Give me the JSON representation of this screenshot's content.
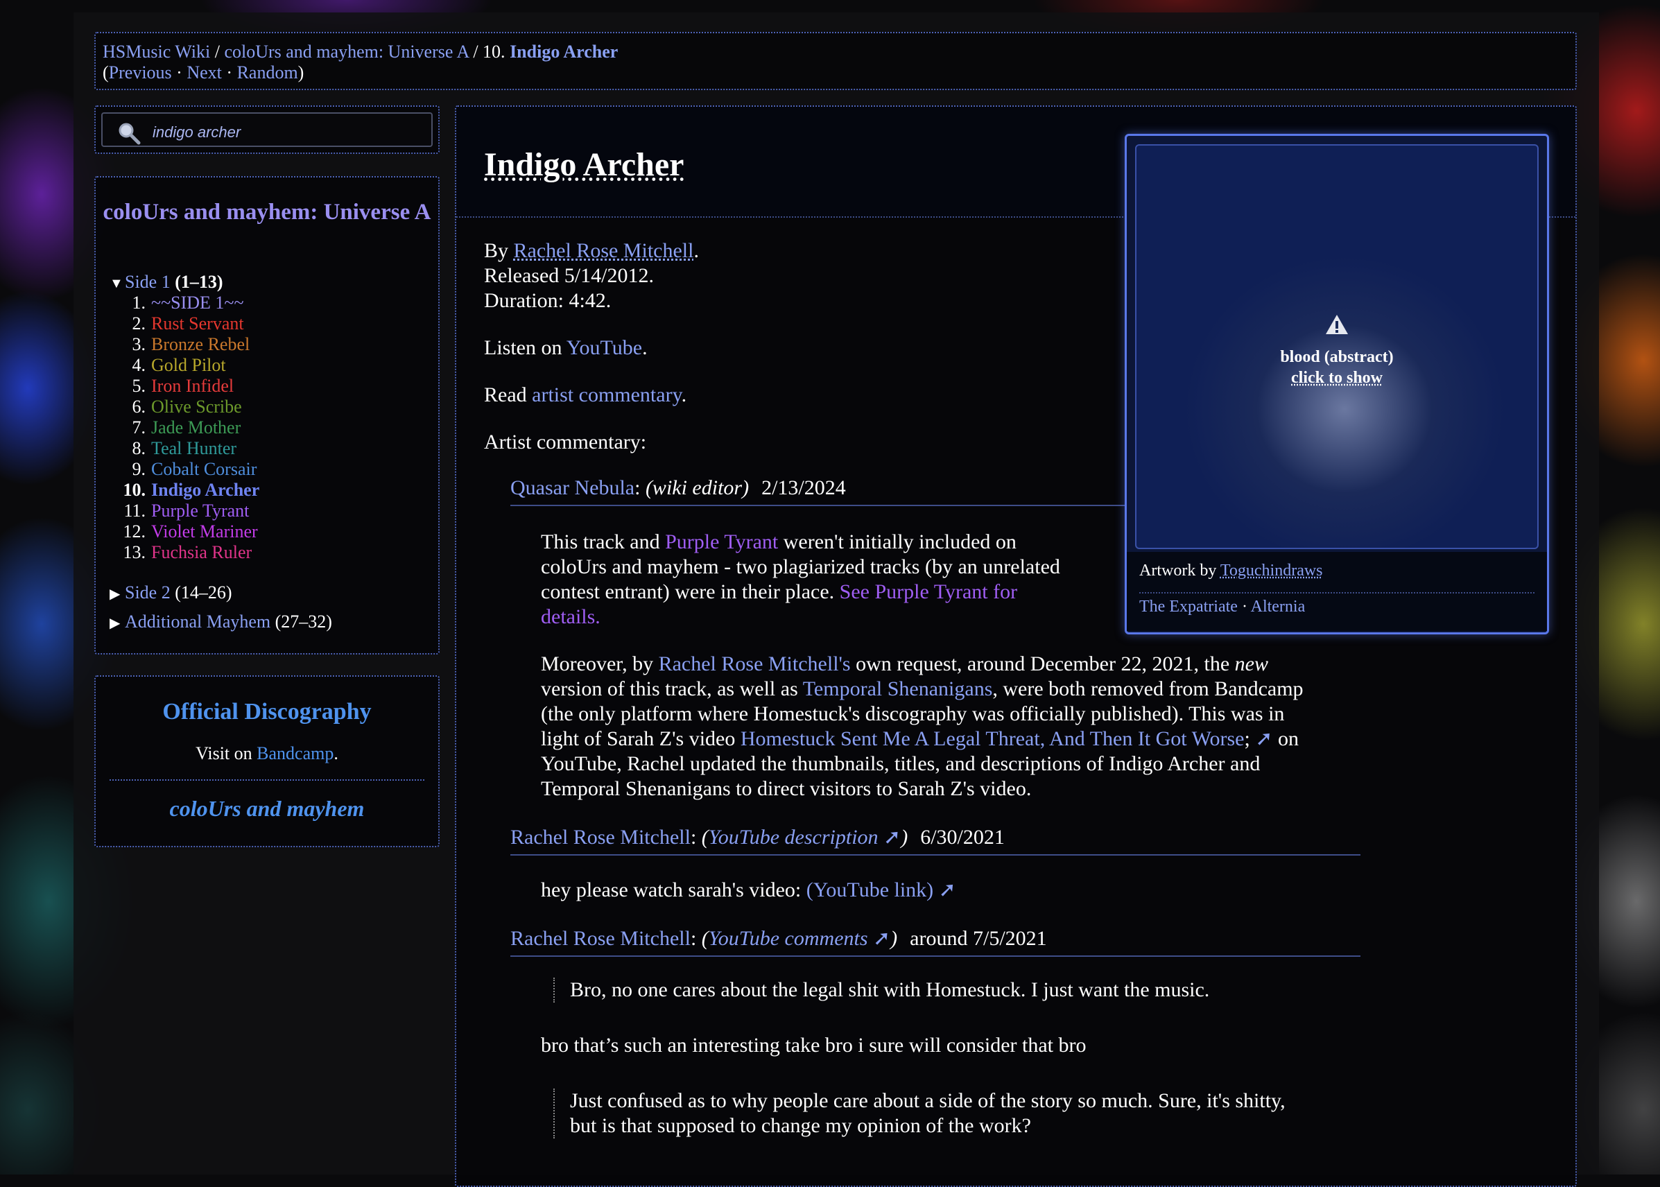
{
  "colors": {
    "link": "#8aa0f2",
    "purple_link": "#a05ef4",
    "official": "#4f93ee",
    "border": "#4e63b8"
  },
  "nav": {
    "home": "HSMusic Wiki",
    "sep1": " / ",
    "album": "coloUrs and mayhem: Universe A",
    "sep2": " / 10. ",
    "current": "Indigo Archer",
    "open_paren": "(",
    "previous": "Previous",
    "dot1": " · ",
    "next": "Next",
    "dot2": " · ",
    "random": "Random",
    "close_paren": ")"
  },
  "search": {
    "icon": "magnifier-icon",
    "value": "indigo archer"
  },
  "sidebar": {
    "album_title": "coloUrs and mayhem: Universe A",
    "side1": {
      "label": "Side 1",
      "range": " (1–13)"
    },
    "tracks": [
      {
        "num": "1.",
        "title": "~~SIDE 1~~",
        "color": "#9a8ff0"
      },
      {
        "num": "2.",
        "title": "Rust Servant",
        "color": "#e5372e"
      },
      {
        "num": "3.",
        "title": "Bronze Rebel",
        "color": "#c9782c"
      },
      {
        "num": "4.",
        "title": "Gold Pilot",
        "color": "#b7a72b"
      },
      {
        "num": "5.",
        "title": "Iron Infidel",
        "color": "#e53b3b"
      },
      {
        "num": "6.",
        "title": "Olive Scribe",
        "color": "#6d9a2b"
      },
      {
        "num": "7.",
        "title": "Jade Mother",
        "color": "#3c9a55"
      },
      {
        "num": "8.",
        "title": "Teal Hunter",
        "color": "#2f9a9a"
      },
      {
        "num": "9.",
        "title": "Cobalt Corsair",
        "color": "#4f8edd"
      },
      {
        "num": "10.",
        "title": "Indigo Archer",
        "color": "#6f84f2"
      },
      {
        "num": "11.",
        "title": "Purple Tyrant",
        "color": "#a05ef4"
      },
      {
        "num": "12.",
        "title": "Violet Mariner",
        "color": "#c23ce8"
      },
      {
        "num": "13.",
        "title": "Fuchsia Ruler",
        "color": "#e0348a"
      }
    ],
    "side2": {
      "label": "Side 2",
      "range": " (14–26)"
    },
    "additional": {
      "label": "Additional Mayhem",
      "range": " (27–32)"
    }
  },
  "discography": {
    "title": "Official Discography",
    "visit_prefix": "Visit on ",
    "visit_link": "Bandcamp",
    "visit_suffix": ".",
    "album": "coloUrs and mayhem"
  },
  "track": {
    "title": "Indigo Archer",
    "by_prefix": "By ",
    "artist": "Rachel Rose Mitchell",
    "by_suffix": ".",
    "released": "Released 5/14/2012.",
    "duration": "Duration: 4:42.",
    "listen_prefix": "Listen on ",
    "listen_link": "YouTube",
    "listen_suffix": ".",
    "read_prefix": "Read ",
    "read_link": "artist commentary",
    "read_suffix": ".",
    "commentary_heading": "Artist commentary:"
  },
  "commentary": [
    {
      "author": "Quasar Nebula",
      "colon": ": ",
      "source": "(wiki editor)",
      "date": "2/13/2024",
      "p1": {
        "a": "This track and ",
        "link1": "Purple Tyrant",
        "b": " weren't initially included on",
        "line2": "coloUrs and mayhem - two plagiarized tracks (by an unrelated",
        "line3a": "contest entrant) were in their place. ",
        "link2a": "See Purple Tyrant for",
        "link2b": "details."
      },
      "p2": {
        "a": "Moreover, by ",
        "link1": "Rachel Rose Mitchell's",
        "b": " own request, around December 22, 2021, the ",
        "em": "new",
        "line2a": "version of this track, as well as ",
        "link2": "Temporal Shenanigans",
        "line2b": ", were both removed from Bandcamp",
        "line3": "(the only platform where Homestuck's discography was officially published). This was in",
        "line4a": "light of Sarah Z's video ",
        "link3": "Homestuck Sent Me A Legal Threat, And Then It Got Worse",
        "line4b": "; ",
        "arrow": "➚",
        "line4c": " on",
        "line5": "YouTube, Rachel updated the thumbnails, titles, and descriptions of Indigo Archer and",
        "line6": "Temporal Shenanigans to direct visitors to Sarah Z's video."
      }
    },
    {
      "author": "Rachel Rose Mitchell",
      "colon": ": ",
      "source_open": "(",
      "source": "YouTube description",
      "arrow": " ➚",
      "source_close": ")",
      "date": "6/30/2021",
      "text": "hey please watch sarah's video: ",
      "link": "(YouTube link)",
      "link_arrow": " ➚"
    },
    {
      "author": "Rachel Rose Mitchell",
      "colon": ": ",
      "source_open": "(",
      "source": "YouTube comments",
      "arrow": " ➚",
      "source_close": ")",
      "date": "around 7/5/2021",
      "quote1": "Bro, no one cares about the legal shit with Homestuck. I just want the music.",
      "reply": "bro that’s such an interesting take bro i sure will consider that bro",
      "quote2a": "Just confused as to why people care about a side of the story so much. Sure, it's shitty,",
      "quote2b": "but is that supposed to change my opinion of the work?"
    }
  ],
  "artwork": {
    "warning_icon": "warning-icon",
    "warning": "blood (abstract)",
    "reveal": "click to show",
    "by_prefix": "Artwork by ",
    "artist": "Toguchindraws",
    "tag1": "The Expatriate",
    "tag_sep": " · ",
    "tag2": "Alternia"
  }
}
